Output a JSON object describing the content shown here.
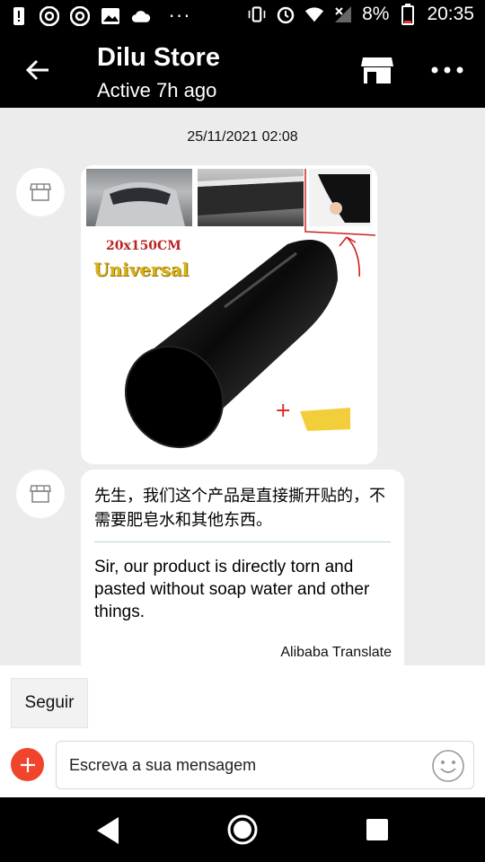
{
  "status_bar": {
    "battery_text": "8%",
    "time": "20:35",
    "overflow": "···",
    "icons": [
      "alert-icon",
      "chrome-icon",
      "chrome-icon",
      "gallery-icon",
      "cloud-icon",
      "vibrate-icon",
      "alarm-icon",
      "wifi-icon",
      "signal-icon",
      "battery-icon"
    ]
  },
  "header": {
    "store_name": "Dilu Store",
    "active_status": "Active 7h ago"
  },
  "chat": {
    "timestamp": "25/11/2021 02:08",
    "product_image": {
      "size_label": "20x150CM",
      "universal_label": "Universal"
    },
    "message": {
      "zh": "先生，我们这个产品是直接撕开贴的，不需要肥皂水和其他东西。",
      "en": "Sir, our product is directly torn and pasted without soap water and other things.",
      "translator": "Alibaba Translate"
    }
  },
  "bottom": {
    "follow_label": "Seguir",
    "input_placeholder": "Escreva a sua mensagem"
  },
  "colors": {
    "accent_red": "#f0442c",
    "chat_bg": "#ececec",
    "bar_bg": "#000000"
  }
}
